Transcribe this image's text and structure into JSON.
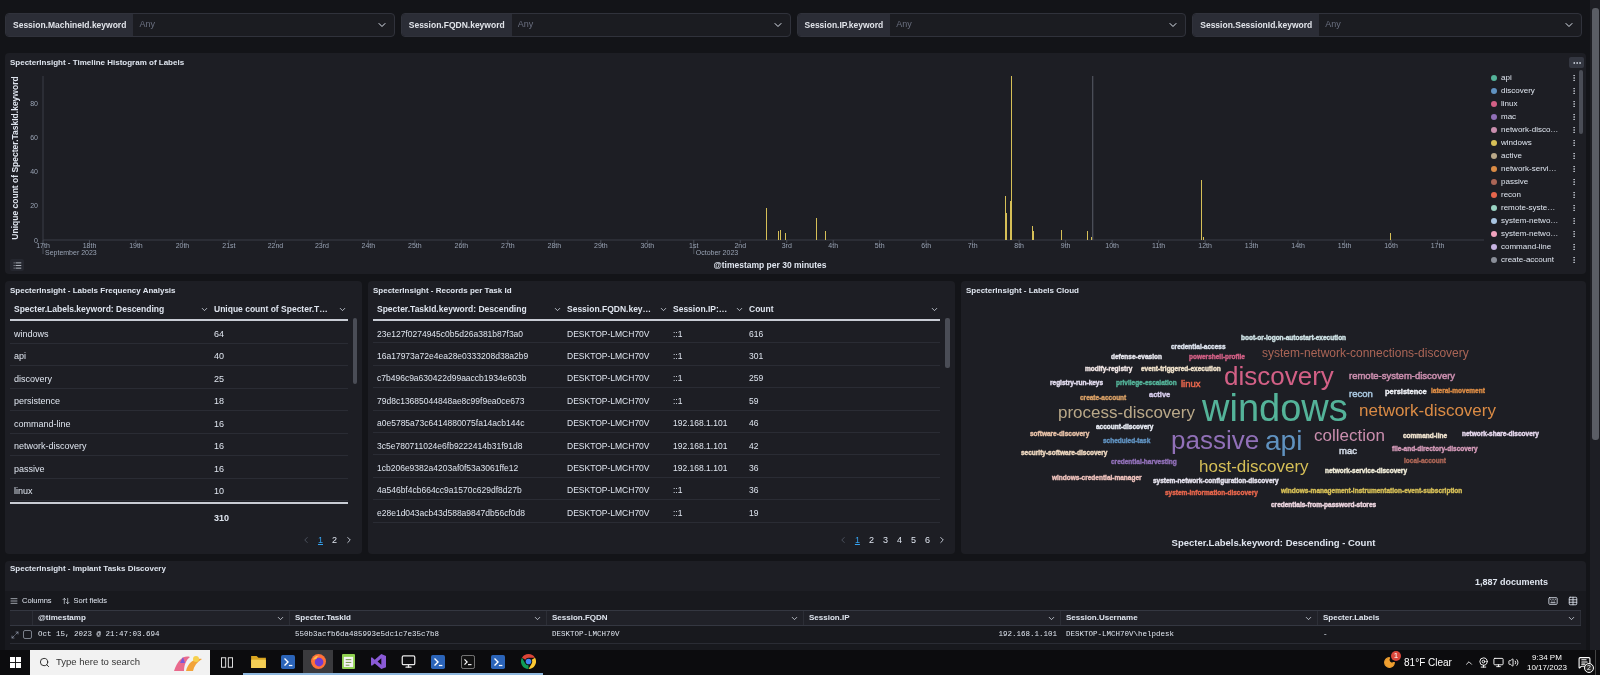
{
  "filters": [
    {
      "label": "Session.MachineId.keyword",
      "placeholder": "Any"
    },
    {
      "label": "Session.FQDN.keyword",
      "placeholder": "Any"
    },
    {
      "label": "Session.IP.keyword",
      "placeholder": "Any"
    },
    {
      "label": "Session.SessionId.keyword",
      "placeholder": "Any"
    }
  ],
  "histogram": {
    "title": "SpecterInsight - Timeline Histogram of Labels",
    "chart_data": {
      "type": "bar",
      "xlabel": "@timestamp per 30 minutes",
      "ylabel": "Unique count of Specter.TaskId.keyword",
      "x": [
        "2023-10-02T13:30",
        "2023-10-02T20:00",
        "2023-10-02T21:00",
        "2023-10-02T23:30",
        "2023-10-03T15:30",
        "2023-10-03T20:00",
        "2023-10-07T17:00",
        "2023-10-07T17:30",
        "2023-10-07T19:30",
        "2023-10-07T20:00",
        "2023-10-08T07:00",
        "2023-10-08T07:30",
        "2023-10-08T22:00",
        "2023-10-09T11:30",
        "2023-10-09T13:30",
        "2023-10-11T22:00",
        "2023-10-11T23:00",
        "2023-10-15T23:30"
      ],
      "series": [
        {
          "color": "#d6bf57",
          "values": [
            19,
            5,
            6,
            4,
            13,
            5,
            26,
            16,
            23,
            96,
            8,
            5,
            6,
            5,
            2,
            35,
            2,
            4
          ]
        }
      ],
      "xlim": [
        "2023-09-17T00:00",
        "2023-10-18T00:00"
      ],
      "ylim": [
        0,
        96
      ],
      "xticks": [
        {
          "value": "2023-09-17T00:00",
          "label": "17th"
        },
        {
          "value": "2023-09-18T00:00",
          "label": "18th"
        },
        {
          "value": "2023-09-19T00:00",
          "label": "19th"
        },
        {
          "value": "2023-09-20T00:00",
          "label": "20th"
        },
        {
          "value": "2023-09-21T00:00",
          "label": "21st"
        },
        {
          "value": "2023-09-22T00:00",
          "label": "22nd"
        },
        {
          "value": "2023-09-23T00:00",
          "label": "23rd"
        },
        {
          "value": "2023-09-24T00:00",
          "label": "24th"
        },
        {
          "value": "2023-09-25T00:00",
          "label": "25th"
        },
        {
          "value": "2023-09-26T00:00",
          "label": "26th"
        },
        {
          "value": "2023-09-27T00:00",
          "label": "27th"
        },
        {
          "value": "2023-09-28T00:00",
          "label": "28th"
        },
        {
          "value": "2023-09-29T00:00",
          "label": "29th"
        },
        {
          "value": "2023-09-30T00:00",
          "label": "30th"
        },
        {
          "value": "2023-10-01T00:00",
          "label": "1st"
        },
        {
          "value": "2023-10-02T00:00",
          "label": "2nd"
        },
        {
          "value": "2023-10-03T00:00",
          "label": "3rd"
        },
        {
          "value": "2023-10-04T00:00",
          "label": "4th"
        },
        {
          "value": "2023-10-05T00:00",
          "label": "5th"
        },
        {
          "value": "2023-10-06T00:00",
          "label": "6th"
        },
        {
          "value": "2023-10-07T00:00",
          "label": "7th"
        },
        {
          "value": "2023-10-08T00:00",
          "label": "8th"
        },
        {
          "value": "2023-10-09T00:00",
          "label": "9th"
        },
        {
          "value": "2023-10-10T00:00",
          "label": "10th"
        },
        {
          "value": "2023-10-11T00:00",
          "label": "11th"
        },
        {
          "value": "2023-10-12T00:00",
          "label": "12th"
        },
        {
          "value": "2023-10-13T00:00",
          "label": "13th"
        },
        {
          "value": "2023-10-14T00:00",
          "label": "14th"
        },
        {
          "value": "2023-10-15T00:00",
          "label": "15th"
        },
        {
          "value": "2023-10-16T00:00",
          "label": "16th"
        },
        {
          "value": "2023-10-17T00:00",
          "label": "17th"
        }
      ],
      "yticks": [
        0,
        20,
        40,
        60,
        80
      ],
      "annotations": [
        "September 2023",
        "October 2023"
      ],
      "ref_lines": [
        {
          "axis": "x",
          "value": "2023-10-09T14:00"
        }
      ]
    },
    "legend": [
      {
        "label": "api",
        "color": "#54b399"
      },
      {
        "label": "discovery",
        "color": "#6092c0"
      },
      {
        "label": "linux",
        "color": "#d36086"
      },
      {
        "label": "mac",
        "color": "#9170b8"
      },
      {
        "label": "network-disco…",
        "color": "#ca8eae"
      },
      {
        "label": "windows",
        "color": "#d6bf57"
      },
      {
        "label": "active",
        "color": "#b9a888"
      },
      {
        "label": "network-servi…",
        "color": "#da8b45"
      },
      {
        "label": "passive",
        "color": "#aa6556"
      },
      {
        "label": "recon",
        "color": "#e7664c"
      },
      {
        "label": "remote-syste…",
        "color": "#9ad4c3"
      },
      {
        "label": "system-netwo…",
        "color": "#a8c4e0"
      },
      {
        "label": "system-netwo…",
        "color": "#f0a2bd"
      },
      {
        "label": "command-line",
        "color": "#c6b2e0"
      },
      {
        "label": "create-account",
        "color": "#8a8e98"
      }
    ]
  },
  "labels_frequency": {
    "title": "SpecterInsight - Labels Frequency Analysis",
    "columns": [
      "Specter.Labels.keyword: Descending",
      "Unique count of Specter.T…"
    ],
    "rows": [
      [
        "windows",
        "64"
      ],
      [
        "api",
        "40"
      ],
      [
        "discovery",
        "25"
      ],
      [
        "persistence",
        "18"
      ],
      [
        "command-line",
        "16"
      ],
      [
        "network-discovery",
        "16"
      ],
      [
        "passive",
        "16"
      ],
      [
        "linux",
        "10"
      ]
    ],
    "total": "310",
    "pages": [
      {
        "label": "1",
        "selected": true
      },
      {
        "label": "2",
        "selected": false
      }
    ]
  },
  "records_per_task": {
    "title": "SpecterInsight - Records per Task Id",
    "columns": [
      "Specter.TaskId.keyword: Descending",
      "Session.FQDN.key…",
      "Session.IP:…",
      "Count"
    ],
    "rows": [
      [
        "23e127f0274945c0b5d26a381b87f3a0",
        "DESKTOP-LMCH70V",
        "::1",
        "616"
      ],
      [
        "16a17973a72e4ea28e0333208d38a2b9",
        "DESKTOP-LMCH70V",
        "::1",
        "301"
      ],
      [
        "c7b496c9a630422d99aaccb1934e603b",
        "DESKTOP-LMCH70V",
        "::1",
        "259"
      ],
      [
        "79d8c13685044848ae8c99f9ea0ce673",
        "DESKTOP-LMCH70V",
        "::1",
        "59"
      ],
      [
        "a0e5785a73c6414880075fa14acb144c",
        "DESKTOP-LMCH70V",
        "192.168.1.101",
        "46"
      ],
      [
        "3c5e780711024e6fb9222414b31f91d8",
        "DESKTOP-LMCH70V",
        "192.168.1.101",
        "42"
      ],
      [
        "1cb206e9382a4203af0f53a3061ffe12",
        "DESKTOP-LMCH70V",
        "192.168.1.101",
        "36"
      ],
      [
        "4a546bf4cb664cc9a1570c629df8d27b",
        "DESKTOP-LMCH70V",
        "::1",
        "36"
      ],
      [
        "e28e1d043acb43d588a9847db56cf0d8",
        "DESKTOP-LMCH70V",
        "::1",
        "19"
      ]
    ],
    "pages": [
      {
        "label": "1",
        "selected": true
      },
      {
        "label": "2",
        "selected": false
      },
      {
        "label": "3",
        "selected": false
      },
      {
        "label": "4",
        "selected": false
      },
      {
        "label": "5",
        "selected": false
      },
      {
        "label": "6",
        "selected": false
      }
    ]
  },
  "labels_cloud": {
    "title": "SpecterInsight - Labels Cloud",
    "words": [
      {
        "text": "boot-or-logon-autostart-execution",
        "color": "#cfe3e6",
        "kind": "mini"
      },
      {
        "text": "credential-access",
        "color": "#dde3ee",
        "kind": "mini"
      },
      {
        "text": "defense-evasion",
        "color": "#e6e6ee",
        "kind": "mini"
      },
      {
        "text": "powershell-profile",
        "color": "#d36086",
        "kind": "mini"
      },
      {
        "text": "system-network-connections-discovery",
        "color": "#aa6556",
        "kind": "mid"
      },
      {
        "text": "modify-registry",
        "color": "#efe4e4",
        "kind": "mini"
      },
      {
        "text": "event-triggered-execution",
        "color": "#f1e3cc",
        "kind": "mini"
      },
      {
        "text": "discovery",
        "color": "#d36086",
        "kind": "large"
      },
      {
        "text": "remote-system-discovery",
        "color": "#ca8eae",
        "kind": "small"
      },
      {
        "text": "registry-run-keys",
        "color": "#e2dcef",
        "kind": "mini"
      },
      {
        "text": "privilege-escalation",
        "color": "#54b399",
        "kind": "mini"
      },
      {
        "text": "linux",
        "color": "#e7664c",
        "kind": "small"
      },
      {
        "text": "create-account",
        "color": "#d9a066",
        "kind": "mini"
      },
      {
        "text": "active",
        "color": "#d7cdec",
        "kind": "tiny"
      },
      {
        "text": "recon",
        "color": "#a8c6de",
        "kind": "small"
      },
      {
        "text": "persistence",
        "color": "#eef0f5",
        "kind": "tiny"
      },
      {
        "text": "lateral-movement",
        "color": "#da8b45",
        "kind": "mini"
      },
      {
        "text": "process-discovery",
        "color": "#b9a888",
        "kind": "big"
      },
      {
        "text": "windows",
        "color": "#54b399",
        "kind": "huge"
      },
      {
        "text": "network-discovery",
        "color": "#da8b45",
        "kind": "big"
      },
      {
        "text": "account-discovery",
        "color": "#e6eaf2",
        "kind": "mini"
      },
      {
        "text": "software-discovery",
        "color": "#e8c2a8",
        "kind": "mini"
      },
      {
        "text": "passive",
        "color": "#9170b8",
        "kind": "large"
      },
      {
        "text": "api",
        "color": "#6092c0",
        "kind": "xlarge"
      },
      {
        "text": "collection",
        "color": "#ca8eae",
        "kind": "big"
      },
      {
        "text": "command-line",
        "color": "#f0e4d0",
        "kind": "mini"
      },
      {
        "text": "network-share-discovery",
        "color": "#e6d8ee",
        "kind": "mini"
      },
      {
        "text": "scheduled-task",
        "color": "#6092c0",
        "kind": "mini"
      },
      {
        "text": "security-software-discovery",
        "color": "#eed8c0",
        "kind": "mini"
      },
      {
        "text": "mac",
        "color": "#d2dae6",
        "kind": "small"
      },
      {
        "text": "file-and-directory-discovery",
        "color": "#d49ab8",
        "kind": "mini"
      },
      {
        "text": "credential-harvesting",
        "color": "#9170b8",
        "kind": "mini"
      },
      {
        "text": "host-discovery",
        "color": "#d6bf57",
        "kind": "big"
      },
      {
        "text": "local-account",
        "color": "#aa6556",
        "kind": "mini"
      },
      {
        "text": "network-service-discovery",
        "color": "#f0ecd8",
        "kind": "mini"
      },
      {
        "text": "windows-credential-manager",
        "color": "#eec2bc",
        "kind": "mini"
      },
      {
        "text": "system-network-configuration-discovery",
        "color": "#e6e3ee",
        "kind": "mini"
      },
      {
        "text": "system-information-discovery",
        "color": "#e7664c",
        "kind": "mini"
      },
      {
        "text": "windows-management-instrumentation-event-subscription",
        "color": "#d6bf57",
        "kind": "mini"
      },
      {
        "text": "credentials-from-password-stores",
        "color": "#eed6e0",
        "kind": "mini"
      }
    ],
    "caption": "Specter.Labels.keyword: Descending - Count"
  },
  "implant_tasks": {
    "title": "SpecterInsight - Implant Tasks Discovery",
    "document_count": "1,887 documents",
    "toolbar": [
      {
        "kind": "columns",
        "label": "Columns"
      },
      {
        "kind": "sort",
        "label": "Sort fields"
      }
    ],
    "columns": [
      "@timestamp",
      "Specter.TaskId",
      "Session.FQDN",
      "Session.IP",
      "Session.Username",
      "Specter.Labels"
    ],
    "rows": [
      {
        "checked": false,
        "cells": [
          "Oct 15, 2023 @ 21:47:03.694",
          "550b3acfb6da485993e5dc1c7e35c7b8",
          "DESKTOP-LMCH70V",
          "192.168.1.101",
          "DESKTOP-LMCH70V\\helpdesk",
          "-"
        ]
      }
    ]
  },
  "taskbar": {
    "search_placeholder": "Type here to search",
    "apps": [
      {
        "kind": "folder",
        "active": false,
        "running": true
      },
      {
        "kind": "shell",
        "active": false,
        "running": true
      },
      {
        "kind": "browser",
        "active": true,
        "running": true
      },
      {
        "kind": "notepad",
        "active": false,
        "running": true
      },
      {
        "kind": "ide",
        "active": false,
        "running": true
      },
      {
        "kind": "display",
        "active": false,
        "running": true
      },
      {
        "kind": "shell",
        "active": false,
        "running": true
      },
      {
        "kind": "console",
        "active": false,
        "running": true
      },
      {
        "kind": "shell",
        "active": false,
        "running": true
      },
      {
        "kind": "globe",
        "active": false,
        "running": true
      }
    ],
    "weather": {
      "badge": "1",
      "text": "81°F Clear"
    },
    "time": "9:34 PM",
    "date": "10/17/2023",
    "notification_badge": "2"
  }
}
